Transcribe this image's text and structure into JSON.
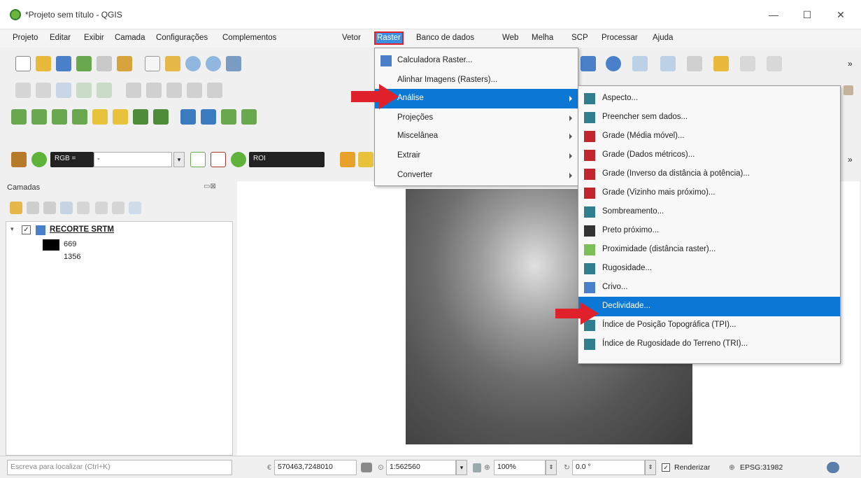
{
  "window": {
    "title": "*Projeto sem título - QGIS",
    "minimize": "—",
    "maximize": "☐",
    "close": "✕"
  },
  "menubar": [
    "Projeto",
    "Editar",
    "Exibir",
    "Camada",
    "Configurações",
    "Complementos",
    "Vetor",
    "Raster",
    "Banco de dados",
    "Web",
    "Melha",
    "SCP",
    "Processar",
    "Ajuda"
  ],
  "toolbar": {
    "rgb_label": "RGB =",
    "roi_label": "ROI",
    "rgb_value": "-",
    "overflow": "»"
  },
  "layers": {
    "header": "Camadas",
    "layer_name": "RECORTE SRTM",
    "value_min": "669",
    "value_max": "1356"
  },
  "raster_menu": [
    "Calculadora Raster...",
    "Alinhar Imagens (Rasters)...",
    "Análise",
    "Projeções",
    "Miscelânea",
    "Extrair",
    "Converter"
  ],
  "analysis_menu": [
    "Aspecto...",
    "Preencher sem dados...",
    "Grade (Média móvel)...",
    "Grade (Dados métricos)...",
    "Grade (Inverso da distância à potência)...",
    "Grade (Vizinho mais próximo)...",
    "Sombreamento...",
    "Preto próximo...",
    "Proximidade (distância raster)...",
    "Rugosidade...",
    "Crivo...",
    "Declividade...",
    "Índice de Posição Topográfica (TPI)...",
    "Índice de Rugosidade do Terreno (TRI)..."
  ],
  "statusbar": {
    "search_placeholder": "Escreva para localizar (Ctrl+K)",
    "coords": "570463,7248010",
    "scale": "1:562560",
    "magnifier": "100%",
    "rotation": "0.0 °",
    "render_label": "Renderizar",
    "crs": "EPSG:31982"
  },
  "colors": {
    "highlight": "#0a78d4",
    "redarrow": "#e0202a"
  }
}
